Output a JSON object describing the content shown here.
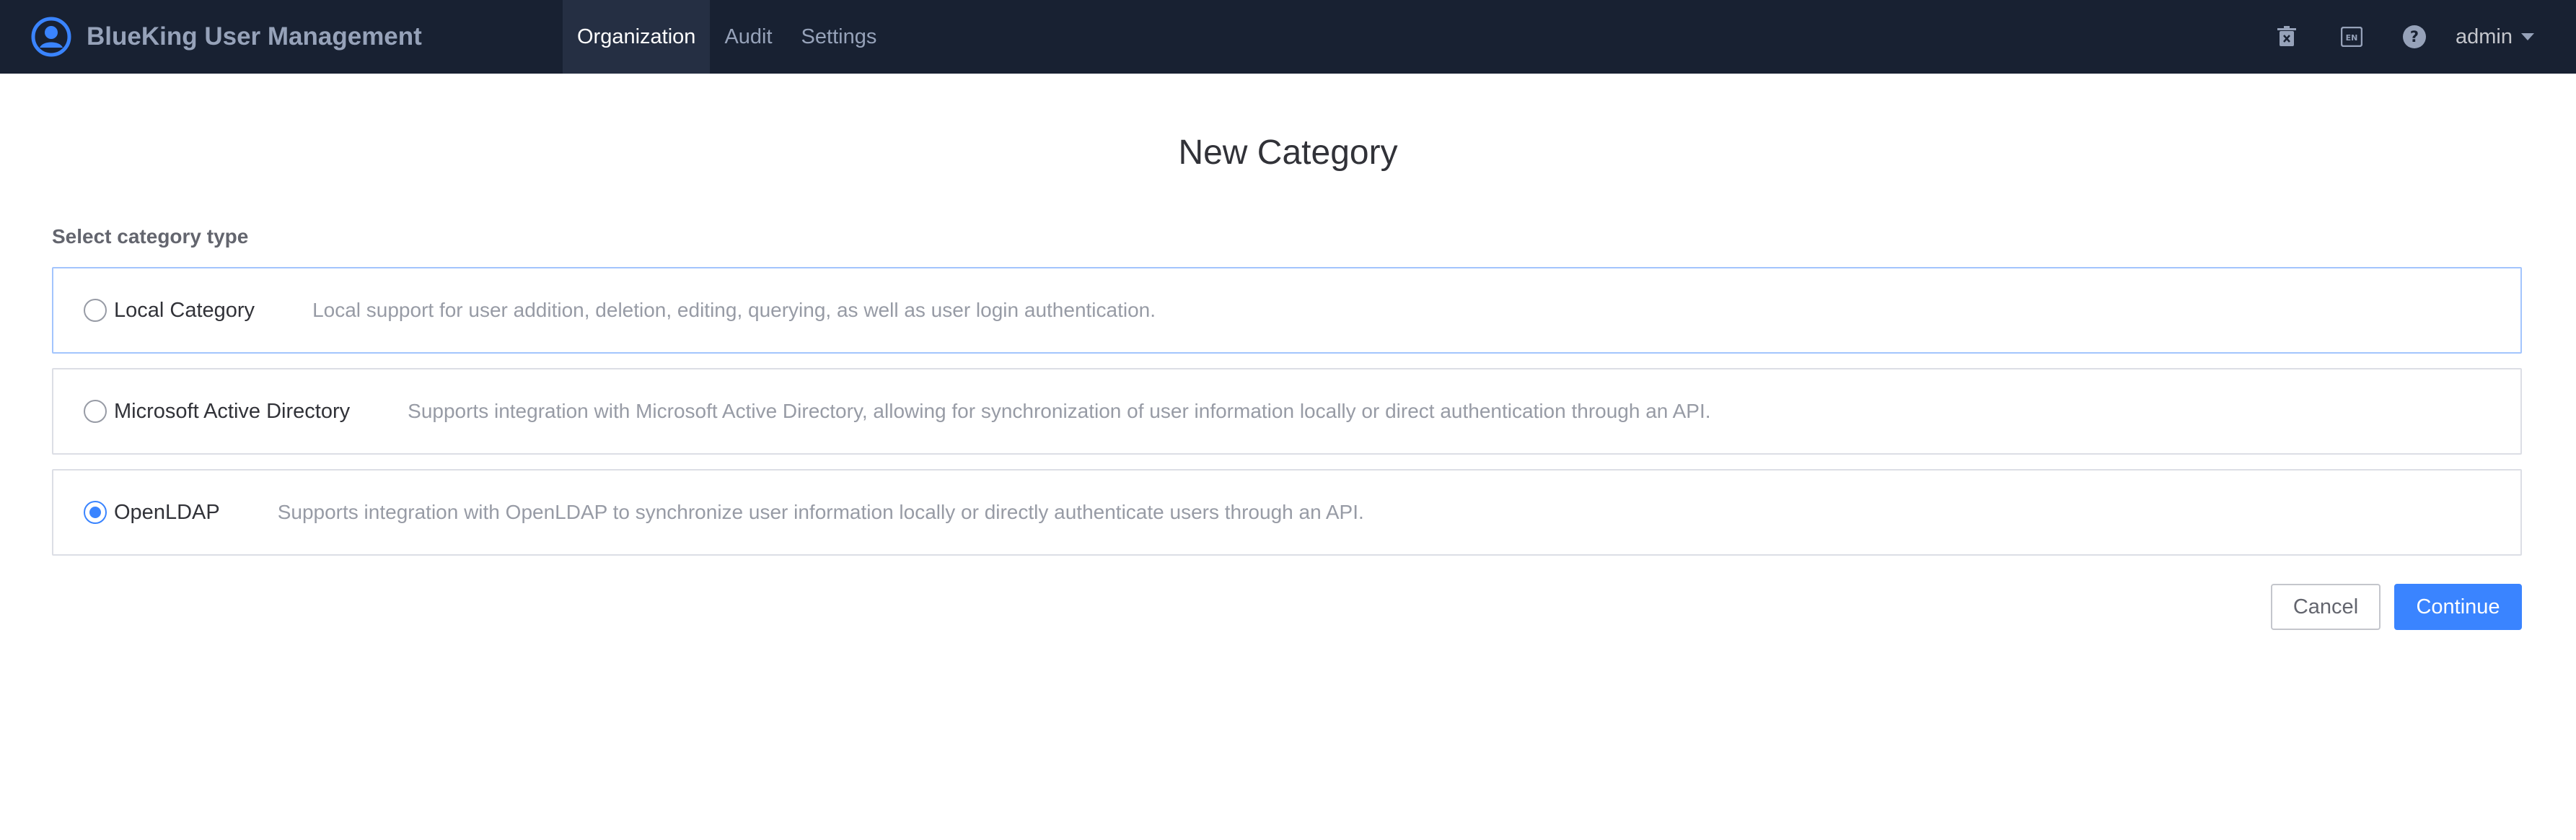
{
  "header": {
    "app_name": "BlueKing User Management",
    "nav": [
      {
        "label": "Organization",
        "active": true
      },
      {
        "label": "Audit",
        "active": false
      },
      {
        "label": "Settings",
        "active": false
      }
    ],
    "tools": [
      "recycle-bin-icon",
      "language-icon",
      "help-icon"
    ],
    "user_name": "admin"
  },
  "page": {
    "title": "New Category",
    "section_label": "Select category type",
    "options": [
      {
        "label": "Local Category",
        "description": "Local support for user addition, deletion, editing, querying, as well as user login authentication.",
        "selected": false
      },
      {
        "label": "Microsoft Active Directory",
        "description": "Supports integration with Microsoft Active Directory, allowing for synchronization of user information locally or direct authentication through an API.",
        "selected": false
      },
      {
        "label": "OpenLDAP",
        "description": "Supports integration with OpenLDAP to synchronize user information locally or directly authenticate users through an API.",
        "selected": true
      }
    ],
    "cancel_label": "Cancel",
    "continue_label": "Continue"
  },
  "colors": {
    "header_bg": "#182132",
    "accent": "#3a84ff"
  }
}
